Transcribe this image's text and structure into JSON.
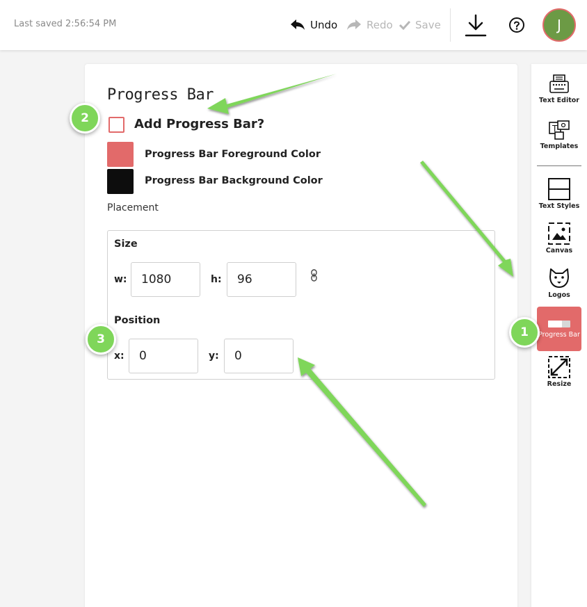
{
  "header": {
    "last_saved": "Last saved 2:56:54 PM",
    "undo_label": "Undo",
    "redo_label": "Redo",
    "save_label": "Save",
    "avatar_initial": "J",
    "avatar_color": "#6c9a45",
    "avatar_border_color": "#e26a6a"
  },
  "panel": {
    "title": "Progress Bar",
    "add_checkbox_label": "Add Progress Bar?",
    "add_checked": false,
    "foreground_label": "Progress Bar Foreground Color",
    "foreground_color": "#e26a6a",
    "background_label": "Progress Bar Background Color",
    "background_color": "#0d0d0d",
    "placement_label": "Placement",
    "size": {
      "label": "Size",
      "w_label": "w:",
      "w_value": "1080",
      "h_label": "h:",
      "h_value": "96"
    },
    "position": {
      "label": "Position",
      "x_label": "x:",
      "x_value": "0",
      "y_label": "y:",
      "y_value": "0"
    }
  },
  "sidebar": {
    "items": [
      {
        "label": "Text Editor",
        "icon": "typewriter-icon"
      },
      {
        "label": "Templates",
        "icon": "templates-icon"
      },
      {
        "label": "Text Styles",
        "icon": "text-styles-icon"
      },
      {
        "label": "Canvas",
        "icon": "canvas-icon"
      },
      {
        "label": "Logos",
        "icon": "logos-icon"
      },
      {
        "label": "Progress Bar",
        "icon": "progress-bar-icon",
        "active": true
      },
      {
        "label": "Resize",
        "icon": "resize-icon"
      }
    ],
    "active_color": "#e26a6a"
  },
  "annotations": {
    "badge_1": "1",
    "badge_2": "2",
    "badge_3": "3",
    "arrow_color": "#7fd65a"
  }
}
